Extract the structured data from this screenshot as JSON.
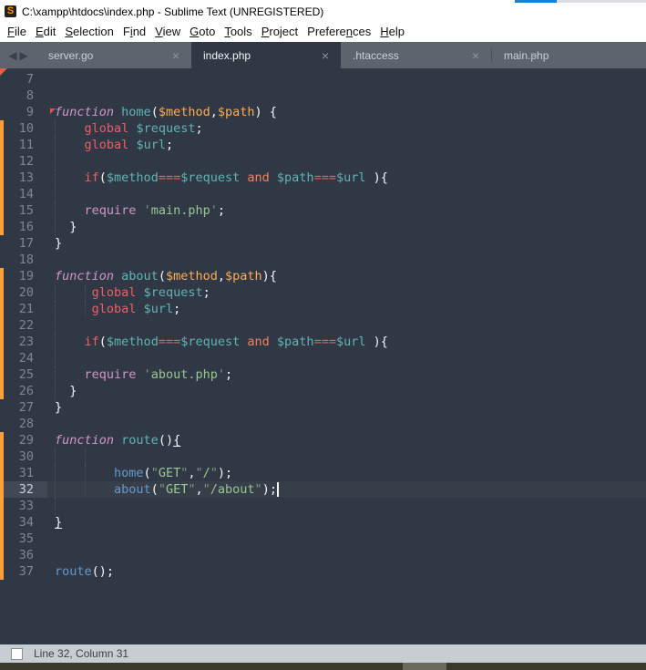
{
  "top_strip": {
    "blue_color": "#1584d8",
    "gray_color": "#dcdde0"
  },
  "titlebar": {
    "icon": "S",
    "title": "C:\\xampp\\htdocs\\index.php - Sublime Text (UNREGISTERED)"
  },
  "menubar": {
    "items": [
      {
        "label": "File",
        "underline_index": 0
      },
      {
        "label": "Edit",
        "underline_index": 0
      },
      {
        "label": "Selection",
        "underline_index": 0
      },
      {
        "label": "Find",
        "underline_index": 1
      },
      {
        "label": "View",
        "underline_index": 0
      },
      {
        "label": "Goto",
        "underline_index": 0
      },
      {
        "label": "Tools",
        "underline_index": 0
      },
      {
        "label": "Project",
        "underline_index": 0
      },
      {
        "label": "Preferences",
        "underline_index": 7
      },
      {
        "label": "Help",
        "underline_index": 0
      }
    ]
  },
  "tabbar": {
    "nav_left_icon": "◀",
    "nav_right_icon": "▶",
    "close_icon": "×",
    "tabs": [
      {
        "label": "server.go",
        "active": false
      },
      {
        "label": "index.php",
        "active": true
      },
      {
        "label": ".htaccess",
        "active": false
      },
      {
        "label": "main.php",
        "active": false
      }
    ]
  },
  "editor": {
    "current_line": 32,
    "cursor": {
      "line": 32,
      "column": 31
    },
    "colors": {
      "background": "#313845",
      "keyword_pink": "#cf96c8",
      "keyword_red": "#ec5f66",
      "operator_orange": "#f0825f",
      "param_orange": "#f9ae58",
      "variable_teal": "#5fb4b4",
      "call_blue": "#6699cc",
      "string_green": "#99c794",
      "modified_bar_orange": "#ffa03c"
    },
    "dirty_bars": [
      {
        "from_line": 10,
        "to_line": 16
      },
      {
        "from_line": 19,
        "to_line": 26
      },
      {
        "from_line": 29,
        "to_line": 37
      }
    ],
    "lines": [
      {
        "n": 7,
        "guides": [],
        "tokens": []
      },
      {
        "n": 8,
        "guides": [],
        "tokens": []
      },
      {
        "n": 9,
        "guides": [],
        "tokens": [
          [
            "function",
            "kw"
          ],
          [
            " ",
            "pl"
          ],
          [
            "home",
            "var"
          ],
          [
            "(",
            "pl"
          ],
          [
            "$method",
            "par"
          ],
          [
            ",",
            "pl"
          ],
          [
            "$path",
            "par"
          ],
          [
            ") {",
            "pl"
          ]
        ]
      },
      {
        "n": 10,
        "guides": [
          0
        ],
        "tokens": [
          [
            "    ",
            "pl"
          ],
          [
            "global",
            "red"
          ],
          [
            " ",
            "pl"
          ],
          [
            "$request",
            "var"
          ],
          [
            ";",
            "pl"
          ]
        ]
      },
      {
        "n": 11,
        "guides": [
          0
        ],
        "tokens": [
          [
            "    ",
            "pl"
          ],
          [
            "global",
            "red"
          ],
          [
            " ",
            "pl"
          ],
          [
            "$url",
            "var"
          ],
          [
            ";",
            "pl"
          ]
        ]
      },
      {
        "n": 12,
        "guides": [
          0
        ],
        "tokens": []
      },
      {
        "n": 13,
        "guides": [
          0
        ],
        "tokens": [
          [
            "    ",
            "pl"
          ],
          [
            "if",
            "red"
          ],
          [
            "(",
            "pl"
          ],
          [
            "$method",
            "var"
          ],
          [
            "===",
            "red"
          ],
          [
            "$request",
            "var"
          ],
          [
            " ",
            "pl"
          ],
          [
            "and",
            "and"
          ],
          [
            " ",
            "pl"
          ],
          [
            "$path",
            "var"
          ],
          [
            "===",
            "red"
          ],
          [
            "$url",
            "var"
          ],
          [
            " ){",
            "pl"
          ]
        ]
      },
      {
        "n": 14,
        "guides": [
          0
        ],
        "tokens": []
      },
      {
        "n": 15,
        "guides": [
          0
        ],
        "tokens": [
          [
            "    ",
            "pl"
          ],
          [
            "require",
            "kwr"
          ],
          [
            " ",
            "pl"
          ],
          [
            "'",
            "qt"
          ],
          [
            "main.php",
            "str"
          ],
          [
            "'",
            "qt"
          ],
          [
            ";",
            "pl"
          ]
        ]
      },
      {
        "n": 16,
        "guides": [
          0
        ],
        "tokens": [
          [
            "  }",
            "pl"
          ]
        ]
      },
      {
        "n": 17,
        "guides": [],
        "tokens": [
          [
            "}",
            "pl"
          ]
        ]
      },
      {
        "n": 18,
        "guides": [],
        "tokens": []
      },
      {
        "n": 19,
        "guides": [],
        "tokens": [
          [
            "function",
            "kw"
          ],
          [
            " ",
            "pl"
          ],
          [
            "about",
            "var"
          ],
          [
            "(",
            "pl"
          ],
          [
            "$method",
            "par"
          ],
          [
            ",",
            "pl"
          ],
          [
            "$path",
            "par"
          ],
          [
            "){",
            "pl"
          ]
        ]
      },
      {
        "n": 20,
        "guides": [
          0,
          4
        ],
        "tokens": [
          [
            "     ",
            "pl"
          ],
          [
            "global",
            "red"
          ],
          [
            " ",
            "pl"
          ],
          [
            "$request",
            "var"
          ],
          [
            ";",
            "pl"
          ]
        ]
      },
      {
        "n": 21,
        "guides": [
          0,
          4
        ],
        "tokens": [
          [
            "     ",
            "pl"
          ],
          [
            "global",
            "red"
          ],
          [
            " ",
            "pl"
          ],
          [
            "$url",
            "var"
          ],
          [
            ";",
            "pl"
          ]
        ]
      },
      {
        "n": 22,
        "guides": [
          0
        ],
        "tokens": []
      },
      {
        "n": 23,
        "guides": [
          0
        ],
        "tokens": [
          [
            "    ",
            "pl"
          ],
          [
            "if",
            "red"
          ],
          [
            "(",
            "pl"
          ],
          [
            "$method",
            "var"
          ],
          [
            "===",
            "red"
          ],
          [
            "$request",
            "var"
          ],
          [
            " ",
            "pl"
          ],
          [
            "and",
            "and"
          ],
          [
            " ",
            "pl"
          ],
          [
            "$path",
            "var"
          ],
          [
            "===",
            "red"
          ],
          [
            "$url",
            "var"
          ],
          [
            " ){",
            "pl"
          ]
        ]
      },
      {
        "n": 24,
        "guides": [
          0
        ],
        "tokens": []
      },
      {
        "n": 25,
        "guides": [
          0
        ],
        "tokens": [
          [
            "    ",
            "pl"
          ],
          [
            "require",
            "kwr"
          ],
          [
            " ",
            "pl"
          ],
          [
            "'",
            "qt"
          ],
          [
            "about.php",
            "str"
          ],
          [
            "'",
            "qt"
          ],
          [
            ";",
            "pl"
          ]
        ]
      },
      {
        "n": 26,
        "guides": [
          0
        ],
        "tokens": [
          [
            "  }",
            "pl"
          ]
        ]
      },
      {
        "n": 27,
        "guides": [],
        "tokens": [
          [
            "}",
            "pl"
          ]
        ]
      },
      {
        "n": 28,
        "guides": [],
        "tokens": []
      },
      {
        "n": 29,
        "guides": [],
        "tokens": [
          [
            "function",
            "kw"
          ],
          [
            " ",
            "pl"
          ],
          [
            "route",
            "var"
          ],
          [
            "()",
            "pl"
          ],
          [
            "{",
            "pl u"
          ]
        ]
      },
      {
        "n": 30,
        "guides": [
          0,
          4
        ],
        "tokens": []
      },
      {
        "n": 31,
        "guides": [
          0,
          4
        ],
        "tokens": [
          [
            "        ",
            "pl"
          ],
          [
            "home",
            "call"
          ],
          [
            "(",
            "pl"
          ],
          [
            "\"",
            "qt"
          ],
          [
            "GET",
            "str"
          ],
          [
            "\"",
            "qt"
          ],
          [
            ",",
            "pl"
          ],
          [
            "\"",
            "qt"
          ],
          [
            "/",
            "str"
          ],
          [
            "\"",
            "qt"
          ],
          [
            ");",
            "pl"
          ]
        ]
      },
      {
        "n": 32,
        "guides": [
          0,
          4
        ],
        "tokens": [
          [
            "        ",
            "pl"
          ],
          [
            "about",
            "call"
          ],
          [
            "(",
            "pl"
          ],
          [
            "\"",
            "qt"
          ],
          [
            "GET",
            "str"
          ],
          [
            "\"",
            "qt"
          ],
          [
            ",",
            "pl"
          ],
          [
            "\"",
            "qt"
          ],
          [
            "/about",
            "str"
          ],
          [
            "\"",
            "qt"
          ],
          [
            ");",
            "pl"
          ]
        ]
      },
      {
        "n": 33,
        "guides": [
          0
        ],
        "tokens": []
      },
      {
        "n": 34,
        "guides": [],
        "tokens": [
          [
            "}",
            "pl u"
          ]
        ]
      },
      {
        "n": 35,
        "guides": [],
        "tokens": []
      },
      {
        "n": 36,
        "guides": [],
        "tokens": []
      },
      {
        "n": 37,
        "guides": [],
        "tokens": [
          [
            "route",
            "call"
          ],
          [
            "();",
            "pl"
          ]
        ]
      }
    ]
  },
  "statusbar": {
    "text": "Line 32, Column 31"
  },
  "bottom_strip": {
    "base_color": "#3a392b",
    "segment_color": "#6b695a"
  }
}
